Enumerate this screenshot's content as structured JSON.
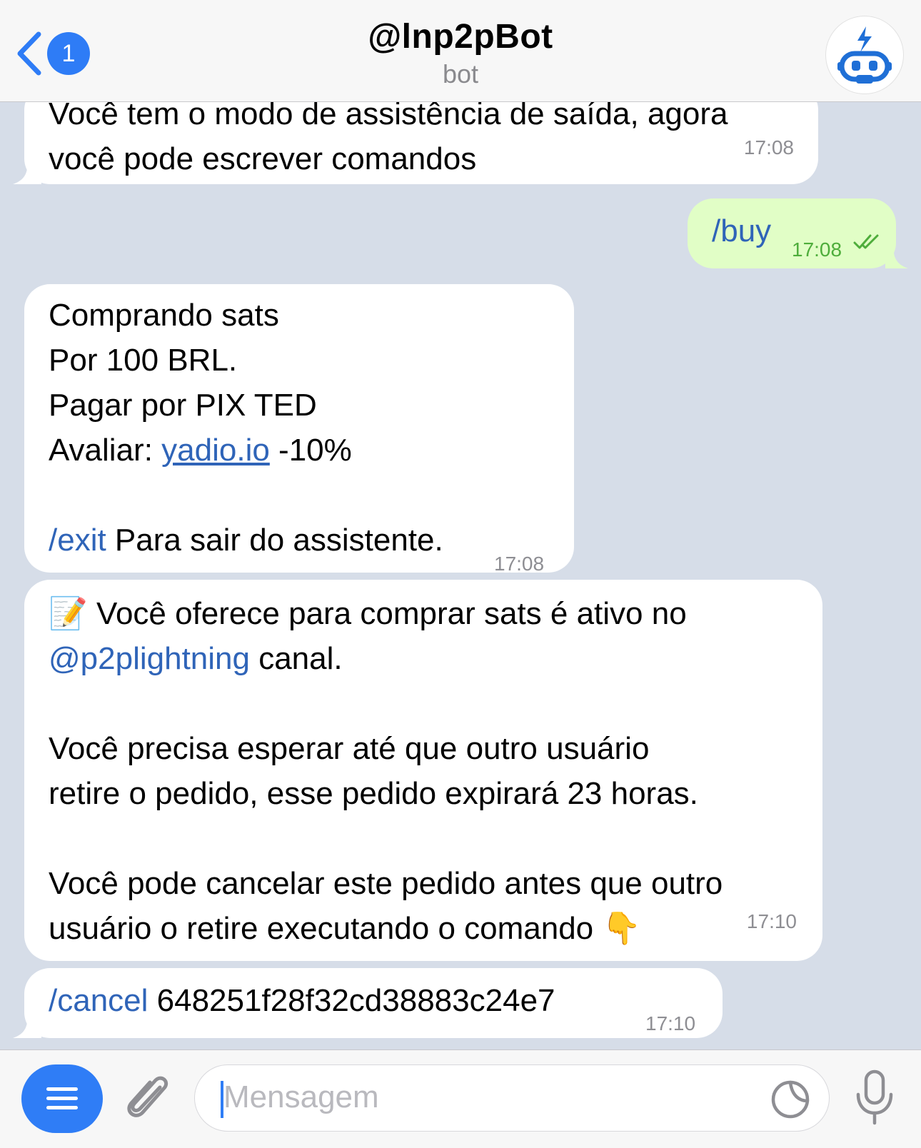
{
  "header": {
    "back_badge": "1",
    "title": "@lnp2pBot",
    "subtitle": "bot"
  },
  "messages": {
    "m1": {
      "line1": "Você tem o modo de assistência de saída, agora",
      "line2": "você pode escrever comandos",
      "time": "17:08"
    },
    "m2": {
      "text": "/buy",
      "time": "17:08"
    },
    "m3": {
      "line1": "Comprando sats",
      "line2": "Por 100 BRL.",
      "line3": "Pagar por PIX TED",
      "line4_prefix": "Avaliar: ",
      "line4_link": "yadio.io",
      "line4_suffix": " -10%",
      "line6_cmd": "/exit",
      "line6_text": " Para sair do assistente.",
      "time": "17:08"
    },
    "m4": {
      "emoji": "📝",
      "line1": " Você oferece para comprar sats é ativo no",
      "line2_link": "@p2plightning",
      "line2_text": " canal.",
      "line4": "Você precisa esperar até que outro usuário",
      "line5": "retire o pedido, esse pedido expirará 23 horas.",
      "line7": "Você pode cancelar este pedido antes que outro",
      "line8": "usuário o retire executando o comando ",
      "line8_emoji": "👇",
      "time": "17:10"
    },
    "m5": {
      "cmd": "/cancel",
      "text": " 648251f28f32cd38883c24e7",
      "time": "17:10"
    }
  },
  "composer": {
    "placeholder": "Mensagem"
  },
  "icons": {
    "back": "chevron-left-icon",
    "menu": "menu-icon",
    "attach": "paperclip-icon",
    "sticker": "sticker-icon",
    "mic": "microphone-icon",
    "read": "double-check-icon",
    "avatar": "robot-avatar"
  },
  "colors": {
    "accent": "#2f7df6",
    "link": "#2f64b8",
    "outgoing_bubble": "#e1fec6",
    "chat_background": "#d6dde8"
  }
}
